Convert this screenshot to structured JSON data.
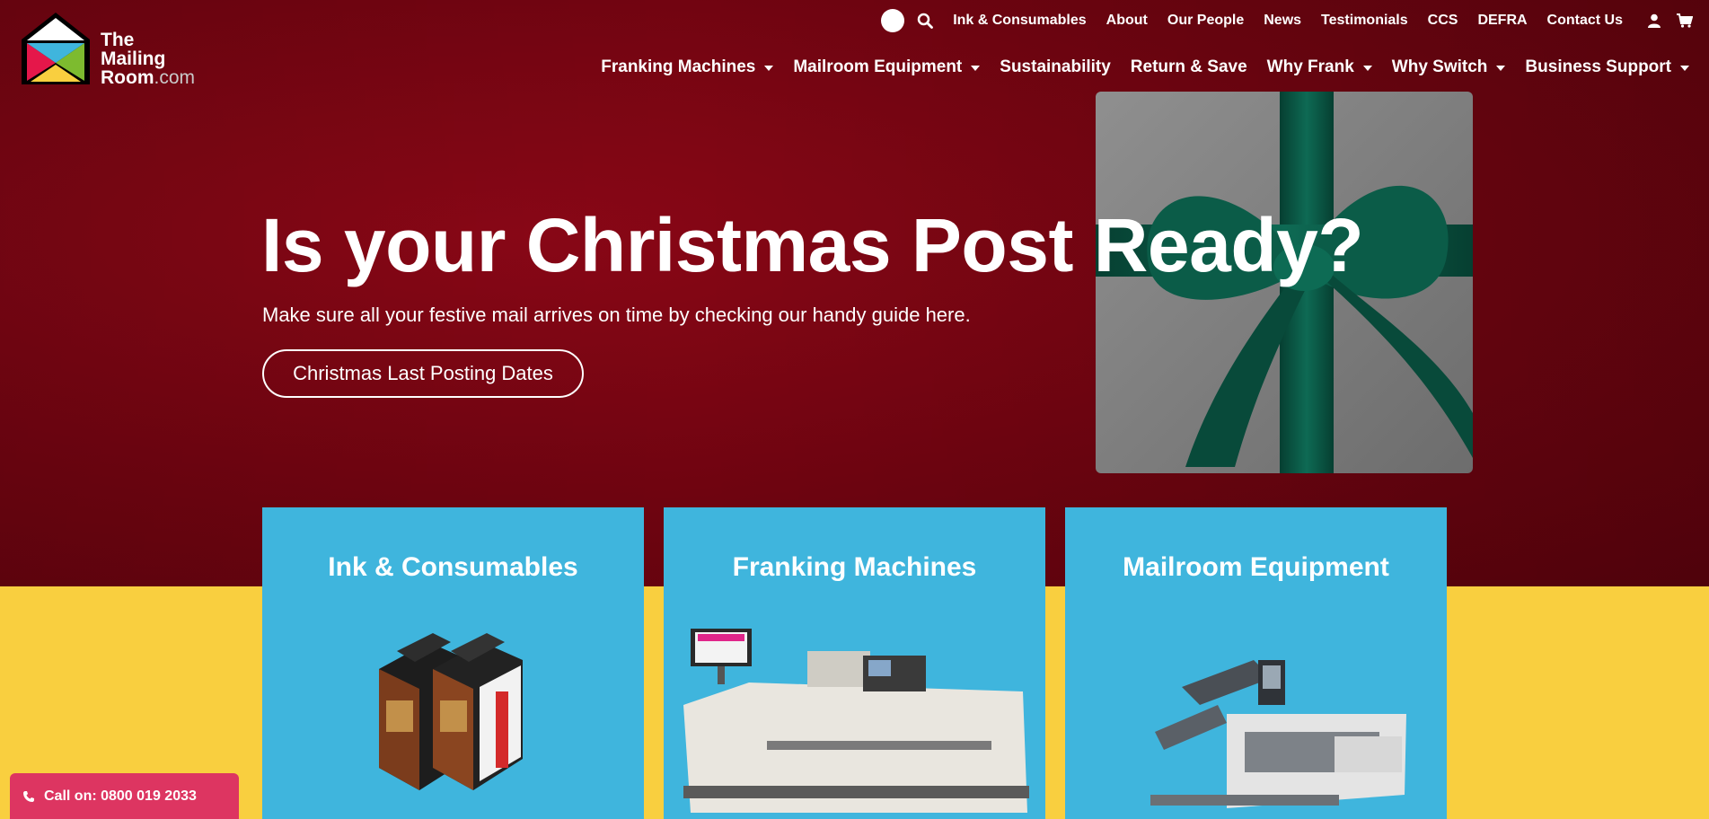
{
  "brand": {
    "line1": "The",
    "line2": "Mailing",
    "line3": "Room",
    "suffix": ".com",
    "colors": {
      "red": "#e5174a",
      "blue": "#3fb5dd",
      "green": "#7dbb2f",
      "yellow": "#f9cf3f"
    }
  },
  "topbar": {
    "links": [
      "Ink & Consumables",
      "About",
      "Our People",
      "News",
      "Testimonials",
      "CCS",
      "DEFRA",
      "Contact Us"
    ],
    "icons": [
      "toggle-icon",
      "search-icon",
      "user-icon",
      "cart-icon"
    ]
  },
  "mainnav": {
    "items": [
      {
        "label": "Franking Machines",
        "dropdown": true
      },
      {
        "label": "Mailroom Equipment",
        "dropdown": true
      },
      {
        "label": "Sustainability",
        "dropdown": false
      },
      {
        "label": "Return & Save",
        "dropdown": false
      },
      {
        "label": "Why Frank",
        "dropdown": true
      },
      {
        "label": "Why Switch",
        "dropdown": true
      },
      {
        "label": "Business Support",
        "dropdown": true
      }
    ]
  },
  "hero": {
    "title": "Is your Christmas Post Ready?",
    "subtitle": "Make sure all your festive mail arrives on time by checking our handy guide here.",
    "button": "Christmas Last Posting Dates",
    "colors": {
      "background": "#6e0410",
      "ribbon": "#0c5a48"
    }
  },
  "cards": [
    {
      "title": "Ink & Consumables"
    },
    {
      "title": "Franking Machines"
    },
    {
      "title": "Mailroom Equipment"
    }
  ],
  "colors": {
    "card": "#3fb5dd",
    "band": "#f9cf3f",
    "call_button": "#dd3561"
  },
  "call": {
    "label": "Call on: 0800 019 2033"
  }
}
